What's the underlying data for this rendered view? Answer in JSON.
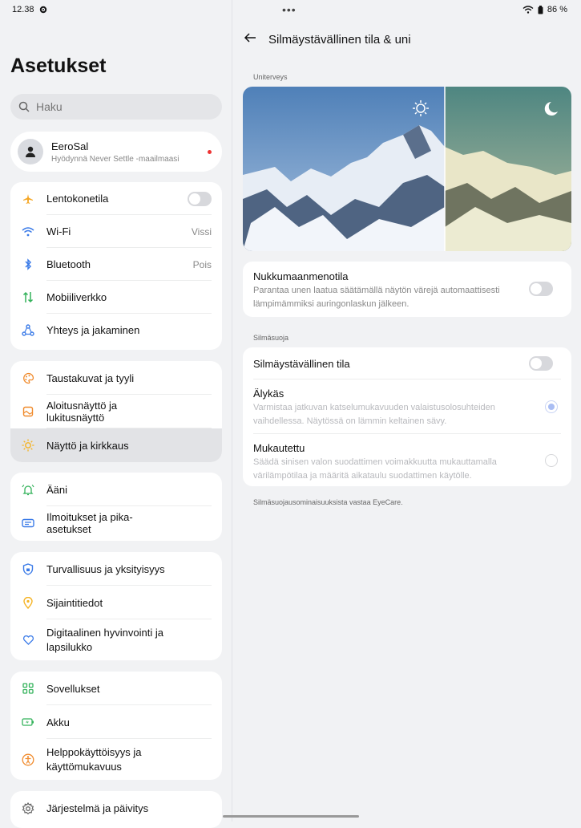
{
  "status": {
    "time": "12.38",
    "battery": "86 %"
  },
  "sidebar": {
    "title": "Asetukset",
    "search_placeholder": "Haku",
    "profile": {
      "name": "EeroSal",
      "subtitle": "Hyödynnä Never Settle -maailmaasi"
    },
    "groups": [
      [
        {
          "label": "Lentokonetila",
          "value": "",
          "icon": "airplane-icon",
          "color": "#f5a623"
        },
        {
          "label": "Wi-Fi",
          "value": "Vissi",
          "icon": "wifi-icon",
          "color": "#3b7be8"
        },
        {
          "label": "Bluetooth",
          "value": "Pois",
          "icon": "bluetooth-icon",
          "color": "#3b7be8"
        },
        {
          "label": "Mobiiliverkko",
          "value": "",
          "icon": "mobile-data-icon",
          "color": "#33b25a"
        },
        {
          "label": "Yhteys ja jakaminen",
          "value": "",
          "icon": "share-icon",
          "color": "#3b7be8"
        }
      ],
      [
        {
          "label": "Taustakuvat ja tyyli",
          "icon": "palette-icon",
          "color": "#f08a2b"
        },
        {
          "label": "Aloitusnäyttö ja lukitusnäyttö",
          "icon": "home-screen-icon",
          "color": "#f08a2b"
        },
        {
          "label": "Näyttö ja kirkkaus",
          "icon": "sun-icon",
          "color": "#f5b323"
        }
      ],
      [
        {
          "label": "Ääni",
          "icon": "bell-icon",
          "color": "#33b25a"
        },
        {
          "label": "Ilmoitukset ja pika-asetukset",
          "icon": "notification-icon",
          "color": "#3b7be8"
        }
      ],
      [
        {
          "label": "Turvallisuus ja yksityisyys",
          "icon": "shield-icon",
          "color": "#3b7be8"
        },
        {
          "label": "Sijaintitiedot",
          "icon": "location-icon",
          "color": "#f5b323"
        },
        {
          "label": "Digitaalinen hyvinvointi ja lapsilukko",
          "icon": "wellbeing-icon",
          "color": "#3b7be8"
        }
      ],
      [
        {
          "label": "Sovellukset",
          "icon": "apps-icon",
          "color": "#33b25a"
        },
        {
          "label": "Akku",
          "icon": "battery-icon",
          "color": "#33b25a"
        },
        {
          "label": "Helppokäyttöisyys ja käyttömukavuus",
          "icon": "accessibility-icon",
          "color": "#f08a2b"
        }
      ],
      [
        {
          "label": "Järjestelmä ja päivitys",
          "icon": "gear-icon",
          "color": "#666666"
        }
      ]
    ]
  },
  "detail": {
    "title": "Silmäystävällinen tila & uni",
    "section_sleep": "Uniterveys",
    "bedtime": {
      "title": "Nukkumaanmenotila",
      "desc": "Parantaa unen laatua säätämällä näytön värejä automaattisesti lämpimämmiksi auringonlaskun jälkeen."
    },
    "section_eye": "Silmäsuoja",
    "eye_mode": "Silmäystävällinen tila",
    "smart": {
      "title": "Älykäs",
      "desc": "Varmistaa jatkuvan katselumukavuuden valaistusolosuhteiden vaihdellessa. Näytössä on lämmin keltainen sävy."
    },
    "custom": {
      "title": "Mukautettu",
      "desc": "Säädä sinisen valon suodattimen voimakkuutta mukauttamalla värilämpötilaa ja määritä aikataulu suodattimen käytölle."
    },
    "footnote": "Silmäsuojausominaisuuksista vastaa EyeCare."
  }
}
